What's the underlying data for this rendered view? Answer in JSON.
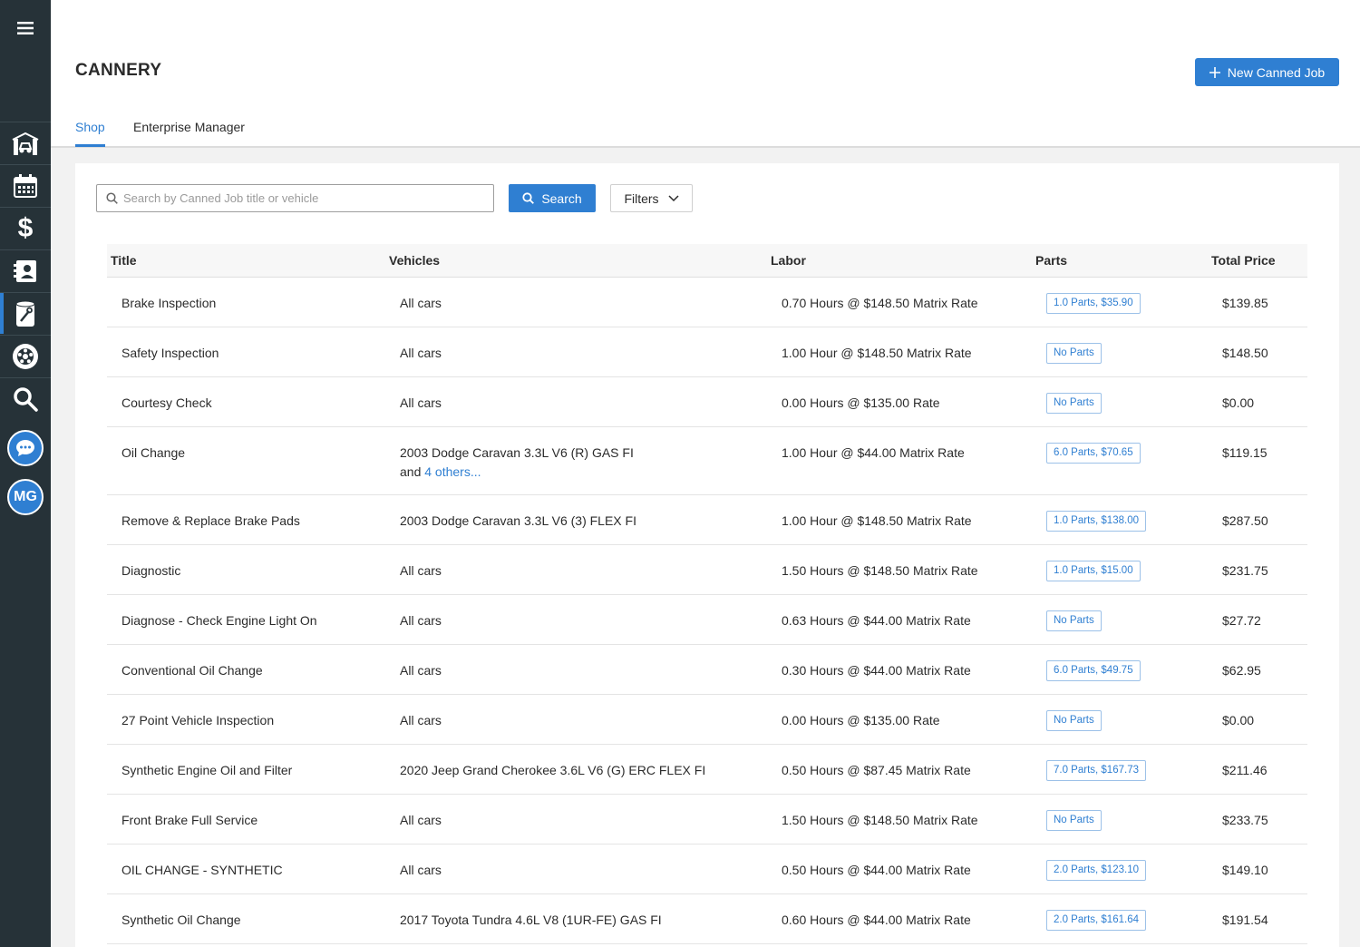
{
  "colors": {
    "sidebar": "#263238",
    "accent": "#2f7fd2",
    "background": "#f2f2f2"
  },
  "sidebar": {
    "menu_icon": "hamburger-icon",
    "items": [
      {
        "icon": "garage-lift-icon"
      },
      {
        "icon": "calendar-icon"
      },
      {
        "icon": "dollar-icon"
      },
      {
        "icon": "contacts-icon"
      },
      {
        "icon": "canned-job-icon"
      },
      {
        "icon": "tire-icon"
      },
      {
        "icon": "search-icon"
      }
    ],
    "chat_icon": "chat-icon",
    "avatar_initials": "MG"
  },
  "header": {
    "title": "CANNERY",
    "new_button_label": "New Canned Job",
    "tabs": [
      {
        "label": "Shop",
        "active": true
      },
      {
        "label": "Enterprise Manager",
        "active": false
      }
    ]
  },
  "search": {
    "placeholder": "Search by Canned Job title or vehicle",
    "value": "",
    "button_label": "Search",
    "filters_label": "Filters"
  },
  "table": {
    "columns": [
      "Title",
      "Vehicles",
      "Labor",
      "Parts",
      "Total Price"
    ],
    "rows": [
      {
        "title": "Brake Inspection",
        "vehicles": "All cars",
        "vehicles_more": "",
        "labor": "0.70 Hours @ $148.50 Matrix Rate",
        "parts": "1.0 Parts, $35.90",
        "total": "$139.85"
      },
      {
        "title": "Safety Inspection",
        "vehicles": "All cars",
        "vehicles_more": "",
        "labor": "1.00 Hour @ $148.50 Matrix Rate",
        "parts": "No Parts",
        "total": "$148.50"
      },
      {
        "title": "Courtesy Check",
        "vehicles": "All cars",
        "vehicles_more": "",
        "labor": "0.00 Hours @ $135.00 Rate",
        "parts": "No Parts",
        "total": "$0.00"
      },
      {
        "title": "Oil Change",
        "vehicles": "2003 Dodge Caravan 3.3L V6 (R) GAS FI",
        "vehicles_and": "and",
        "vehicles_more": "4 others...",
        "labor": "1.00 Hour @ $44.00 Matrix Rate",
        "parts": "6.0 Parts, $70.65",
        "total": "$119.15"
      },
      {
        "title": "Remove & Replace Brake Pads",
        "vehicles": "2003 Dodge Caravan 3.3L V6 (3) FLEX FI",
        "vehicles_more": "",
        "labor": "1.00 Hour @ $148.50 Matrix Rate",
        "parts": "1.0 Parts, $138.00",
        "total": "$287.50"
      },
      {
        "title": "Diagnostic",
        "vehicles": "All cars",
        "vehicles_more": "",
        "labor": "1.50 Hours @ $148.50 Matrix Rate",
        "parts": "1.0 Parts, $15.00",
        "total": "$231.75"
      },
      {
        "title": "Diagnose - Check Engine Light On",
        "vehicles": "All cars",
        "vehicles_more": "",
        "labor": "0.63 Hours @ $44.00 Matrix Rate",
        "parts": "No Parts",
        "total": "$27.72"
      },
      {
        "title": "Conventional Oil Change",
        "vehicles": "All cars",
        "vehicles_more": "",
        "labor": "0.30 Hours @ $44.00 Matrix Rate",
        "parts": "6.0 Parts, $49.75",
        "total": "$62.95"
      },
      {
        "title": "27 Point Vehicle Inspection",
        "vehicles": "All cars",
        "vehicles_more": "",
        "labor": "0.00 Hours @ $135.00 Rate",
        "parts": "No Parts",
        "total": "$0.00"
      },
      {
        "title": "Synthetic Engine Oil and Filter",
        "vehicles": "2020 Jeep Grand Cherokee 3.6L V6 (G) ERC FLEX FI",
        "vehicles_more": "",
        "labor": "0.50 Hours @ $87.45 Matrix Rate",
        "parts": "7.0 Parts, $167.73",
        "total": "$211.46"
      },
      {
        "title": "Front Brake Full Service",
        "vehicles": "All cars",
        "vehicles_more": "",
        "labor": "1.50 Hours @ $148.50 Matrix Rate",
        "parts": "No Parts",
        "total": "$233.75"
      },
      {
        "title": "OIL CHANGE - SYNTHETIC",
        "vehicles": "All cars",
        "vehicles_more": "",
        "labor": "0.50 Hours @ $44.00 Matrix Rate",
        "parts": "2.0 Parts, $123.10",
        "total": "$149.10"
      },
      {
        "title": "Synthetic Oil Change",
        "vehicles": "2017 Toyota Tundra 4.6L V8 (1UR-FE) GAS FI",
        "vehicles_more": "",
        "labor": "0.60 Hours @ $44.00 Matrix Rate",
        "parts": "2.0 Parts, $161.64",
        "total": "$191.54"
      }
    ]
  }
}
